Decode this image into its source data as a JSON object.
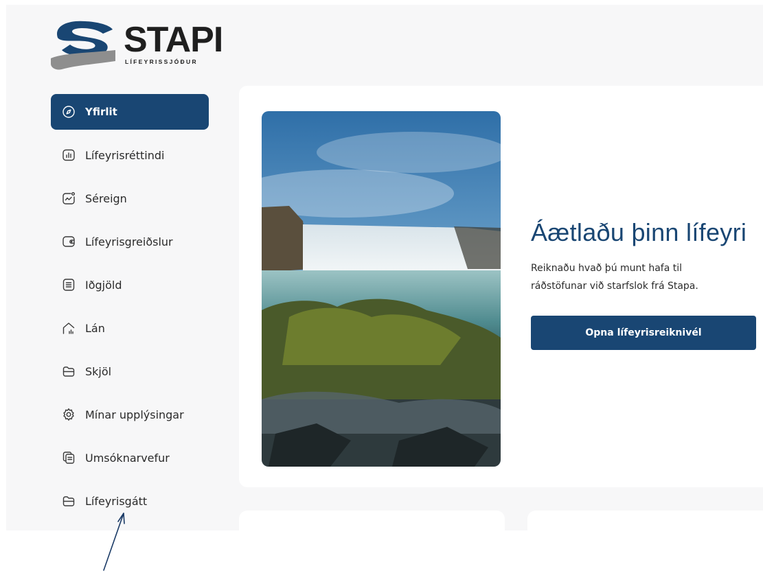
{
  "brand": {
    "name": "STAPI",
    "subtitle": "LÍFEYRISSJÓÐUR",
    "primary_color": "#194673"
  },
  "sidebar": {
    "items": [
      {
        "label": "Yfirlit",
        "icon": "compass-icon",
        "active": true
      },
      {
        "label": "Lífeyrisréttindi",
        "icon": "bar-chart-icon",
        "active": false
      },
      {
        "label": "Séreign",
        "icon": "trend-chart-icon",
        "active": false
      },
      {
        "label": "Lífeyrisgreiðslur",
        "icon": "wallet-icon",
        "active": false
      },
      {
        "label": "Iðgjöld",
        "icon": "list-icon",
        "active": false
      },
      {
        "label": "Lán",
        "icon": "house-chart-icon",
        "active": false
      },
      {
        "label": "Skjöl",
        "icon": "folder-icon",
        "active": false
      },
      {
        "label": "Mínar upplýsingar",
        "icon": "gear-icon",
        "active": false
      },
      {
        "label": "Umsóknarvefur",
        "icon": "documents-icon",
        "active": false
      },
      {
        "label": "Lífeyrisgátt",
        "icon": "folder-icon",
        "active": false
      }
    ]
  },
  "promo": {
    "title": "Áætlaðu þinn lífeyri",
    "text": "Reiknaðu hvað þú munt hafa til ráðstöfunar við starfslok frá Stapa.",
    "button_label": "Opna lífeyrisreiknivél",
    "image": "waterfall-photo"
  }
}
